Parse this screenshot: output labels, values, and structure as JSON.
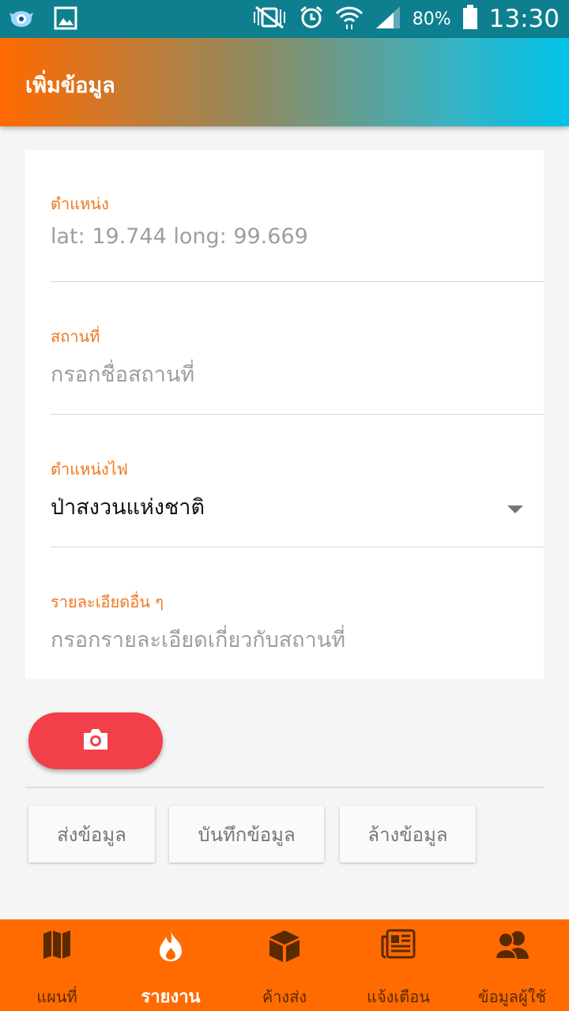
{
  "status_bar": {
    "battery": "80%",
    "time": "13:30",
    "icons": [
      "bird-notification-icon",
      "gallery-icon",
      "mute-vibrate-icon",
      "alarm-icon",
      "wifi-icon",
      "signal-icon",
      "battery-icon"
    ]
  },
  "app_bar": {
    "title": "เพิ่มข้อมูล"
  },
  "form": {
    "position": {
      "label": "ตำแหน่ง",
      "value": "lat: 19.744 long: 99.669"
    },
    "place": {
      "label": "สถานที่",
      "placeholder": "กรอกชื่อสถานที่"
    },
    "fire_location": {
      "label": "ตำแหน่งไฟ",
      "selected": "ป่าสงวนแห่งชาติ"
    },
    "details": {
      "label": "รายละเอียดอื่น ๆ",
      "placeholder": "กรอกรายละเอียดเกี่ยวกับสถานที่"
    }
  },
  "camera_button": {
    "icon": "camera-icon",
    "color": "#f2404a"
  },
  "actions": {
    "send": "ส่งข้อมูล",
    "save": "บันทึกข้อมูล",
    "clear": "ล้างข้อมูล"
  },
  "bottom_nav": {
    "items": [
      {
        "label": "แผนที่",
        "icon": "map-icon",
        "active": false
      },
      {
        "label": "รายงาน",
        "icon": "fire-icon",
        "active": true
      },
      {
        "label": "ค้างส่ง",
        "icon": "box-icon",
        "active": false
      },
      {
        "label": "แจ้งเตือน",
        "icon": "newspaper-icon",
        "active": false
      },
      {
        "label": "ข้อมูลผู้ใช้",
        "icon": "users-icon",
        "active": false
      }
    ]
  },
  "colors": {
    "accent": "#ff6b00",
    "label": "#f07820",
    "danger": "#f2404a"
  }
}
